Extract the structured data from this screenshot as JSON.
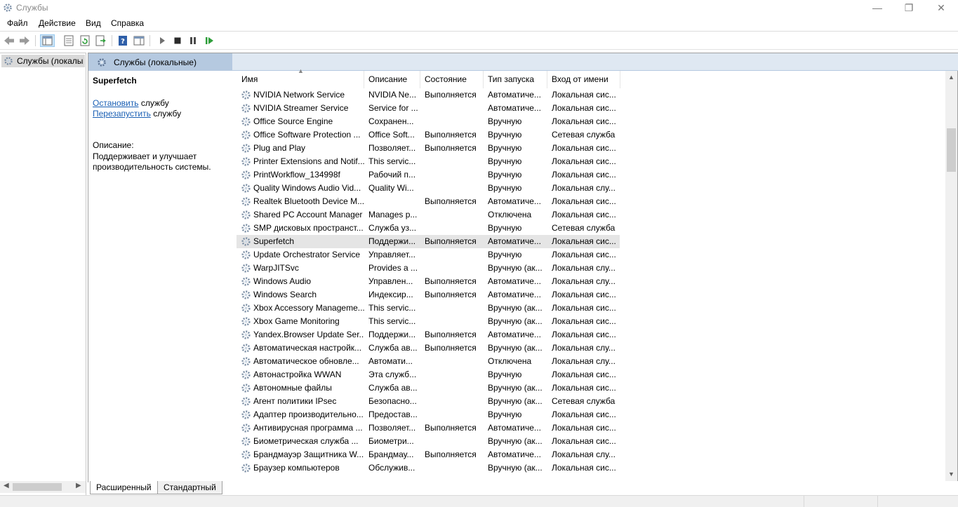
{
  "window": {
    "title": "Службы",
    "controls": {
      "minimize": "—",
      "restore": "❐",
      "close": "✕"
    }
  },
  "menu": [
    "Файл",
    "Действие",
    "Вид",
    "Справка"
  ],
  "tree": {
    "item": "Службы (локалы"
  },
  "header": {
    "title": "Службы (локальные)"
  },
  "detail": {
    "service_name": "Superfetch",
    "stop_link": "Остановить",
    "stop_suffix": " службу",
    "restart_link": "Перезапустить",
    "restart_suffix": " службу",
    "description_label": "Описание:",
    "description_line1": "Поддерживает и улучшает",
    "description_line2": "производительность системы."
  },
  "columns": {
    "name": "Имя",
    "description": "Описание",
    "state": "Состояние",
    "startup": "Тип запуска",
    "logon": "Вход от имени"
  },
  "rows": [
    [
      "NVIDIA Network Service",
      "NVIDIA Ne...",
      "Выполняется",
      "Автоматиче...",
      "Локальная сис..."
    ],
    [
      "NVIDIA Streamer Service",
      "Service for ...",
      "",
      "Автоматиче...",
      "Локальная сис..."
    ],
    [
      "Office  Source Engine",
      "Сохранен...",
      "",
      "Вручную",
      "Локальная сис..."
    ],
    [
      "Office Software Protection ...",
      "Office Soft...",
      "Выполняется",
      "Вручную",
      "Сетевая служба"
    ],
    [
      "Plug and Play",
      "Позволяет...",
      "Выполняется",
      "Вручную",
      "Локальная сис..."
    ],
    [
      "Printer Extensions and Notif...",
      "This servic...",
      "",
      "Вручную",
      "Локальная сис..."
    ],
    [
      "PrintWorkflow_134998f",
      "Рабочий п...",
      "",
      "Вручную",
      "Локальная сис..."
    ],
    [
      "Quality Windows Audio Vid...",
      "Quality Wi...",
      "",
      "Вручную",
      "Локальная слу..."
    ],
    [
      "Realtek Bluetooth Device M...",
      "",
      "Выполняется",
      "Автоматиче...",
      "Локальная сис..."
    ],
    [
      "Shared PC Account Manager",
      "Manages p...",
      "",
      "Отключена",
      "Локальная сис..."
    ],
    [
      "SMP дисковых пространст...",
      "Служба уз...",
      "",
      "Вручную",
      "Сетевая служба"
    ],
    [
      "Superfetch",
      "Поддержи...",
      "Выполняется",
      "Автоматиче...",
      "Локальная сис..."
    ],
    [
      "Update Orchestrator Service",
      "Управляет...",
      "",
      "Вручную",
      "Локальная сис..."
    ],
    [
      "WarpJITSvc",
      "Provides a ...",
      "",
      "Вручную (ак...",
      "Локальная слу..."
    ],
    [
      "Windows Audio",
      "Управлен...",
      "Выполняется",
      "Автоматиче...",
      "Локальная слу..."
    ],
    [
      "Windows Search",
      "Индексир...",
      "Выполняется",
      "Автоматиче...",
      "Локальная сис..."
    ],
    [
      "Xbox Accessory Manageme...",
      "This servic...",
      "",
      "Вручную (ак...",
      "Локальная сис..."
    ],
    [
      "Xbox Game Monitoring",
      "This servic...",
      "",
      "Вручную (ак...",
      "Локальная сис..."
    ],
    [
      "Yandex.Browser Update Ser...",
      "Поддержи...",
      "Выполняется",
      "Автоматиче...",
      "Локальная сис..."
    ],
    [
      "Автоматическая настройк...",
      "Служба ав...",
      "Выполняется",
      "Вручную (ак...",
      "Локальная слу..."
    ],
    [
      "Автоматическое обновле...",
      "Автомати...",
      "",
      "Отключена",
      "Локальная слу..."
    ],
    [
      "Автонастройка WWAN",
      "Эта служб...",
      "",
      "Вручную",
      "Локальная сис..."
    ],
    [
      "Автономные файлы",
      "Служба ав...",
      "",
      "Вручную (ак...",
      "Локальная сис..."
    ],
    [
      "Агент политики IPsec",
      "Безопасно...",
      "",
      "Вручную (ак...",
      "Сетевая служба"
    ],
    [
      "Адаптер производительно...",
      "Предостав...",
      "",
      "Вручную",
      "Локальная сис..."
    ],
    [
      "Антивирусная программа ...",
      "Позволяет...",
      "Выполняется",
      "Автоматиче...",
      "Локальная сис..."
    ],
    [
      "Биометрическая служба ...",
      "Биометри...",
      "",
      "Вручную (ак...",
      "Локальная сис..."
    ],
    [
      "Брандмауэр Защитника W...",
      "Брандмау...",
      "Выполняется",
      "Автоматиче...",
      "Локальная слу..."
    ],
    [
      "Браузер компьютеров",
      "Обслужив...",
      "",
      "Вручную (ак...",
      "Локальная сис..."
    ]
  ],
  "selected_service": "Superfetch",
  "tabs": {
    "extended": "Расширенный",
    "standard": "Стандартный"
  }
}
